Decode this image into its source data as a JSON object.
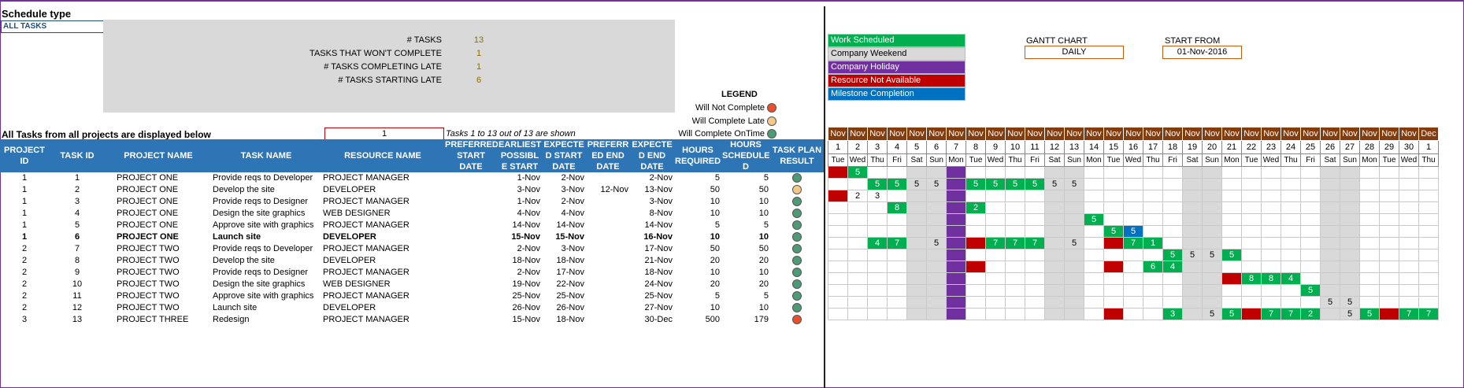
{
  "header": {
    "title": "Schedule type",
    "schedule_type": "ALL TASKS"
  },
  "summary": [
    {
      "label": "# TASKS",
      "value": "13"
    },
    {
      "label": "TASKS THAT WON'T COMPLETE",
      "value": "1"
    },
    {
      "label": "# TASKS COMPLETING LATE",
      "value": "1"
    },
    {
      "label": "# TASKS STARTING LATE",
      "value": "6"
    }
  ],
  "legend": {
    "title": "LEGEND",
    "items": [
      {
        "label": "Will Not Complete",
        "color": "#e8512a"
      },
      {
        "label": "Will Complete Late",
        "color": "#f4c987"
      },
      {
        "label": "Will Complete OnTime",
        "color": "#4e9a77"
      }
    ]
  },
  "caption": "All Tasks from all projects are displayed below",
  "page_input": "1",
  "shown_text": "Tasks 1 to 13 out of 13 are shown",
  "columns": [
    "PROJECT ID",
    "TASK ID",
    "PROJECT NAME",
    "TASK NAME",
    "RESOURCE NAME",
    "PREFERRED START DATE",
    "EARLIEST POSSIBL E START",
    "EXPECTE D START DATE",
    "PREFERR ED END DATE",
    "EXPECTE D END DATE",
    "HOURS REQUIRED",
    "HOURS SCHEDULE D",
    "TASK PLAN RESULT"
  ],
  "rows": [
    {
      "pid": "1",
      "tid": "1",
      "project": "PROJECT ONE",
      "task": "Provide reqs to Developer",
      "resource": "PROJECT MANAGER",
      "pref_start": "",
      "earliest": "1-Nov",
      "exp_start": "2-Nov",
      "pref_end": "",
      "exp_end": "2-Nov",
      "hours_req": "5",
      "hours_sched": "5",
      "result_color": "#4e9a77",
      "bold": false
    },
    {
      "pid": "1",
      "tid": "2",
      "project": "PROJECT ONE",
      "task": "Develop the site",
      "resource": "DEVELOPER",
      "pref_start": "",
      "earliest": "3-Nov",
      "exp_start": "3-Nov",
      "pref_end": "12-Nov",
      "exp_end": "13-Nov",
      "hours_req": "50",
      "hours_sched": "50",
      "result_color": "#f4c987",
      "bold": false
    },
    {
      "pid": "1",
      "tid": "3",
      "project": "PROJECT ONE",
      "task": "Provide reqs to Designer",
      "resource": "PROJECT MANAGER",
      "pref_start": "",
      "earliest": "1-Nov",
      "exp_start": "2-Nov",
      "pref_end": "",
      "exp_end": "3-Nov",
      "hours_req": "10",
      "hours_sched": "10",
      "result_color": "#4e9a77",
      "bold": false
    },
    {
      "pid": "1",
      "tid": "4",
      "project": "PROJECT ONE",
      "task": "Design the site graphics",
      "resource": "WEB DESIGNER",
      "pref_start": "",
      "earliest": "4-Nov",
      "exp_start": "4-Nov",
      "pref_end": "",
      "exp_end": "8-Nov",
      "hours_req": "10",
      "hours_sched": "10",
      "result_color": "#4e9a77",
      "bold": false
    },
    {
      "pid": "1",
      "tid": "5",
      "project": "PROJECT ONE",
      "task": "Approve site with graphics",
      "resource": "PROJECT MANAGER",
      "pref_start": "",
      "earliest": "14-Nov",
      "exp_start": "14-Nov",
      "pref_end": "",
      "exp_end": "14-Nov",
      "hours_req": "5",
      "hours_sched": "5",
      "result_color": "#4e9a77",
      "bold": false
    },
    {
      "pid": "1",
      "tid": "6",
      "project": "PROJECT ONE",
      "task": "Launch site",
      "resource": "DEVELOPER",
      "pref_start": "",
      "earliest": "15-Nov",
      "exp_start": "15-Nov",
      "pref_end": "",
      "exp_end": "16-Nov",
      "hours_req": "10",
      "hours_sched": "10",
      "result_color": "#4e9a77",
      "bold": true
    },
    {
      "pid": "2",
      "tid": "7",
      "project": "PROJECT TWO",
      "task": "Provide reqs to Developer",
      "resource": "PROJECT MANAGER",
      "pref_start": "",
      "earliest": "2-Nov",
      "exp_start": "3-Nov",
      "pref_end": "",
      "exp_end": "17-Nov",
      "hours_req": "50",
      "hours_sched": "50",
      "result_color": "#4e9a77",
      "bold": false
    },
    {
      "pid": "2",
      "tid": "8",
      "project": "PROJECT TWO",
      "task": "Develop the site",
      "resource": "DEVELOPER",
      "pref_start": "",
      "earliest": "18-Nov",
      "exp_start": "18-Nov",
      "pref_end": "",
      "exp_end": "21-Nov",
      "hours_req": "20",
      "hours_sched": "20",
      "result_color": "#4e9a77",
      "bold": false
    },
    {
      "pid": "2",
      "tid": "9",
      "project": "PROJECT TWO",
      "task": "Provide reqs to Designer",
      "resource": "PROJECT MANAGER",
      "pref_start": "",
      "earliest": "2-Nov",
      "exp_start": "17-Nov",
      "pref_end": "",
      "exp_end": "18-Nov",
      "hours_req": "10",
      "hours_sched": "10",
      "result_color": "#4e9a77",
      "bold": false
    },
    {
      "pid": "2",
      "tid": "10",
      "project": "PROJECT TWO",
      "task": "Design the site graphics",
      "resource": "WEB DESIGNER",
      "pref_start": "",
      "earliest": "19-Nov",
      "exp_start": "22-Nov",
      "pref_end": "",
      "exp_end": "24-Nov",
      "hours_req": "20",
      "hours_sched": "20",
      "result_color": "#4e9a77",
      "bold": false
    },
    {
      "pid": "2",
      "tid": "11",
      "project": "PROJECT TWO",
      "task": "Approve site with graphics",
      "resource": "PROJECT MANAGER",
      "pref_start": "",
      "earliest": "25-Nov",
      "exp_start": "25-Nov",
      "pref_end": "",
      "exp_end": "25-Nov",
      "hours_req": "5",
      "hours_sched": "5",
      "result_color": "#4e9a77",
      "bold": false
    },
    {
      "pid": "2",
      "tid": "12",
      "project": "PROJECT TWO",
      "task": "Launch site",
      "resource": "DEVELOPER",
      "pref_start": "",
      "earliest": "26-Nov",
      "exp_start": "26-Nov",
      "pref_end": "",
      "exp_end": "27-Nov",
      "hours_req": "10",
      "hours_sched": "10",
      "result_color": "#4e9a77",
      "bold": false
    },
    {
      "pid": "3",
      "tid": "13",
      "project": "PROJECT THREE",
      "task": "Redesign",
      "resource": "PROJECT MANAGER",
      "pref_start": "",
      "earliest": "15-Nov",
      "exp_start": "18-Nov",
      "pref_end": "",
      "exp_end": "30-Dec",
      "hours_req": "500",
      "hours_sched": "179",
      "result_color": "#e8512a",
      "bold": false
    }
  ],
  "gantt_key": [
    {
      "label": "Work Scheduled",
      "bg": "#00b050",
      "fg": "#ffffff"
    },
    {
      "label": "Company Weekend",
      "bg": "#d9d9d9",
      "fg": "#000000"
    },
    {
      "label": "Company Holiday",
      "bg": "#7030a0",
      "fg": "#ffffff"
    },
    {
      "label": "Resource Not Available",
      "bg": "#c00000",
      "fg": "#ffffff"
    },
    {
      "label": "Milestone Completion",
      "bg": "#0070c0",
      "fg": "#ffffff"
    }
  ],
  "gantt_chart": {
    "label": "GANTT CHART",
    "value": "DAILY"
  },
  "start_from": {
    "label": "START FROM",
    "value": "01-Nov-2016"
  },
  "gantt": {
    "months": [
      "Nov",
      "Nov",
      "Nov",
      "Nov",
      "Nov",
      "Nov",
      "Nov",
      "Nov",
      "Nov",
      "Nov",
      "Nov",
      "Nov",
      "Nov",
      "Nov",
      "Nov",
      "Nov",
      "Nov",
      "Nov",
      "Nov",
      "Nov",
      "Nov",
      "Nov",
      "Nov",
      "Nov",
      "Nov",
      "Nov",
      "Nov",
      "Nov",
      "Nov",
      "Nov",
      "Dec"
    ],
    "days": [
      "1",
      "2",
      "3",
      "4",
      "5",
      "6",
      "7",
      "8",
      "9",
      "10",
      "11",
      "12",
      "13",
      "14",
      "15",
      "16",
      "17",
      "18",
      "19",
      "20",
      "21",
      "22",
      "23",
      "24",
      "25",
      "26",
      "27",
      "28",
      "29",
      "30",
      "1"
    ],
    "weekdays": [
      "Tue",
      "Wed",
      "Thu",
      "Fri",
      "Sat",
      "Sun",
      "Mon",
      "Tue",
      "Wed",
      "Thu",
      "Fri",
      "Sat",
      "Sun",
      "Mon",
      "Tue",
      "Wed",
      "Thu",
      "Fri",
      "Sat",
      "Sun",
      "Mon",
      "Tue",
      "Wed",
      "Thu",
      "Fri",
      "Sat",
      "Sun",
      "Mon",
      "Tue",
      "Wed",
      "Thu"
    ],
    "weekend_cols": [
      4,
      5,
      11,
      12,
      18,
      19,
      25,
      26
    ],
    "holiday_cols": [
      6
    ],
    "rows": [
      [
        [
          0,
          "n",
          ""
        ],
        [
          1,
          "s",
          "5"
        ]
      ],
      [
        [
          2,
          "s",
          "5"
        ],
        [
          3,
          "s",
          "5"
        ],
        [
          4,
          "b",
          "5"
        ],
        [
          5,
          "b",
          "5"
        ],
        [
          7,
          "s",
          "5"
        ],
        [
          8,
          "s",
          "5"
        ],
        [
          9,
          "s",
          "5"
        ],
        [
          10,
          "s",
          "5"
        ],
        [
          11,
          "b",
          "5"
        ],
        [
          12,
          "b",
          "5"
        ]
      ],
      [
        [
          0,
          "n",
          ""
        ],
        [
          1,
          "b",
          "2"
        ],
        [
          2,
          "b",
          "3"
        ]
      ],
      [
        [
          3,
          "s",
          "8"
        ],
        [
          7,
          "s",
          "2"
        ]
      ],
      [
        [
          13,
          "s",
          "5"
        ]
      ],
      [
        [
          14,
          "s",
          "5"
        ],
        [
          15,
          "m",
          "5"
        ]
      ],
      [
        [
          2,
          "s",
          "4"
        ],
        [
          3,
          "s",
          "7"
        ],
        [
          5,
          "b",
          "5"
        ],
        [
          7,
          "n",
          ""
        ],
        [
          8,
          "s",
          "7"
        ],
        [
          9,
          "s",
          "7"
        ],
        [
          10,
          "s",
          "7"
        ],
        [
          12,
          "b",
          "5"
        ],
        [
          14,
          "n",
          ""
        ],
        [
          15,
          "s",
          "7"
        ],
        [
          16,
          "s",
          "1"
        ]
      ],
      [
        [
          17,
          "s",
          "5"
        ],
        [
          18,
          "b",
          "5"
        ],
        [
          19,
          "b",
          "5"
        ],
        [
          20,
          "s",
          "5"
        ]
      ],
      [
        [
          7,
          "n",
          ""
        ],
        [
          14,
          "n",
          ""
        ],
        [
          16,
          "s",
          "6"
        ],
        [
          17,
          "s",
          "4"
        ]
      ],
      [
        [
          20,
          "n",
          ""
        ],
        [
          21,
          "s",
          "8"
        ],
        [
          22,
          "s",
          "8"
        ],
        [
          23,
          "s",
          "4"
        ]
      ],
      [
        [
          24,
          "s",
          "5"
        ]
      ],
      [
        [
          25,
          "b",
          "5"
        ],
        [
          26,
          "b",
          "5"
        ]
      ],
      [
        [
          14,
          "n",
          ""
        ],
        [
          17,
          "s",
          "3"
        ],
        [
          19,
          "b",
          "5"
        ],
        [
          20,
          "s",
          "5"
        ],
        [
          21,
          "n",
          ""
        ],
        [
          22,
          "s",
          "7"
        ],
        [
          23,
          "s",
          "7"
        ],
        [
          24,
          "s",
          "2"
        ],
        [
          26,
          "b",
          "5"
        ],
        [
          27,
          "s",
          "5"
        ],
        [
          28,
          "n",
          ""
        ],
        [
          29,
          "s",
          "7"
        ],
        [
          30,
          "s",
          "7"
        ]
      ]
    ]
  }
}
